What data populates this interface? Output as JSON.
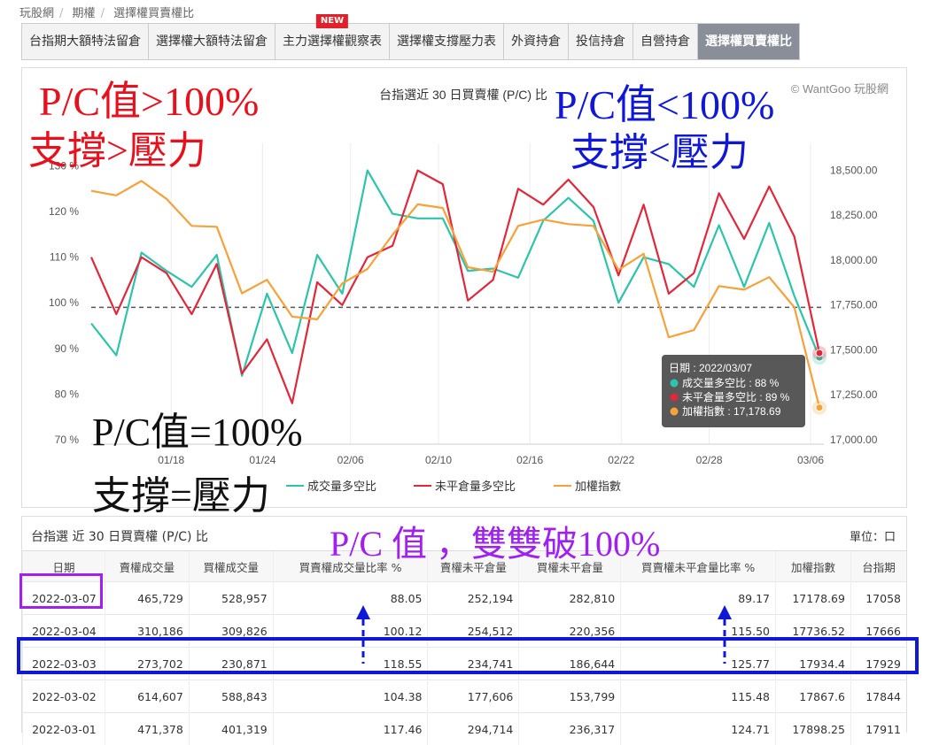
{
  "breadcrumb": [
    "玩股網",
    "期權",
    "選擇權買賣權比"
  ],
  "tabs": [
    {
      "label": "台指期大額特法留倉"
    },
    {
      "label": "選擇權大額特法留倉"
    },
    {
      "label": "主力選擇權觀察表",
      "badge": "NEW"
    },
    {
      "label": "選擇權支撐壓力表"
    },
    {
      "label": "外資持倉"
    },
    {
      "label": "投信持倉"
    },
    {
      "label": "自營持倉"
    },
    {
      "label": "選擇權買賣權比",
      "active": true
    }
  ],
  "chart_data": {
    "type": "line",
    "title": "台指選近 30 日買賣權 (P/C) 比",
    "credit": "© WantGoo 玩股網",
    "x_ticks": [
      "01/18",
      "01/24",
      "02/06",
      "02/10",
      "02/16",
      "02/22",
      "02/28",
      "03/06"
    ],
    "left_axis": {
      "ticks": [
        "70 %",
        "80 %",
        "90 %",
        "100 %",
        "110 %",
        "120 %",
        "130 %"
      ],
      "ylim": [
        70,
        133
      ]
    },
    "right_axis": {
      "ticks": [
        "17,000.00",
        "17,250.00",
        "17,500.00",
        "17,750.00",
        "18,000.00",
        "18,250.00",
        "18,500.00"
      ],
      "ylim": [
        17000,
        18600
      ]
    },
    "reference_line": 99,
    "series": [
      {
        "name": "成交量多空比",
        "color": "#2ec4a9",
        "axis": "left",
        "values": [
          95.5,
          88.5,
          111,
          107,
          103.5,
          110.5,
          84,
          102,
          89,
          110.5,
          102,
          129,
          119.5,
          118.5,
          118.5,
          107,
          107.5,
          105.5,
          118,
          123,
          118,
          100,
          110,
          108.5,
          103.5,
          117,
          103.5,
          117.5,
          101.5,
          88
        ]
      },
      {
        "name": "未平倉量多空比",
        "color": "#e0283c",
        "axis": "left",
        "values": [
          110,
          97.5,
          110,
          106.5,
          97.5,
          108.5,
          84.5,
          92,
          78,
          104.5,
          99.5,
          110,
          112.5,
          129,
          126,
          100.5,
          105,
          125,
          121.5,
          127,
          121,
          106,
          121.5,
          102,
          106.5,
          124,
          114,
          125.5,
          114.5,
          89
        ]
      },
      {
        "name": "加權指數",
        "color": "#f5a23c",
        "axis": "right",
        "values": [
          18385,
          18360,
          18440,
          18340,
          18190,
          18185,
          17815,
          17890,
          17685,
          17670,
          17870,
          17950,
          18140,
          18310,
          18290,
          17960,
          17935,
          18190,
          18225,
          18200,
          18190,
          17945,
          18035,
          17570,
          17610,
          17855,
          17835,
          17905,
          17737,
          17179
        ]
      }
    ],
    "tooltip": {
      "date_label": "日期 : 2022/03/07",
      "rows": [
        {
          "label": "成交量多空比 : 88 %",
          "color": "#2ec4a9"
        },
        {
          "label": "未平倉量多空比 : 89 %",
          "color": "#e0283c"
        },
        {
          "label": "加權指數 : 17,178.69",
          "color": "#f5a23c"
        }
      ]
    }
  },
  "annotations": {
    "pc_gt": "P/C值>100%",
    "support_gt": "支撐>壓力",
    "pc_lt": "P/C值<100%",
    "support_lt": "支撐<壓力",
    "pc_eq": "P/C值=100%",
    "support_eq": "支撐=壓力",
    "double_break": "P/C 值 ，雙雙破100%"
  },
  "table": {
    "title": "台指選 近 30 日買賣權 (P/C) 比",
    "unit": "單位：口",
    "headers": [
      "日期",
      "賣權成交量",
      "買權成交量",
      "買賣權成交量比率 %",
      "賣權未平倉量",
      "買權未平倉量",
      "買賣權未平倉量比率 %",
      "加權指數",
      "台指期"
    ],
    "rows": [
      [
        "2022-03-07",
        "465,729",
        "528,957",
        "88.05",
        "252,194",
        "282,810",
        "89.17",
        "17178.69",
        "17058"
      ],
      [
        "2022-03-04",
        "310,186",
        "309,826",
        "100.12",
        "254,512",
        "220,356",
        "115.50",
        "17736.52",
        "17666"
      ],
      [
        "2022-03-03",
        "273,702",
        "230,871",
        "118.55",
        "234,741",
        "186,644",
        "125.77",
        "17934.4",
        "17929"
      ],
      [
        "2022-03-02",
        "614,607",
        "588,843",
        "104.38",
        "177,606",
        "153,799",
        "115.48",
        "17867.6",
        "17844"
      ],
      [
        "2022-03-01",
        "471,378",
        "401,319",
        "117.46",
        "294,714",
        "236,317",
        "124.71",
        "17898.25",
        "17911"
      ]
    ]
  }
}
